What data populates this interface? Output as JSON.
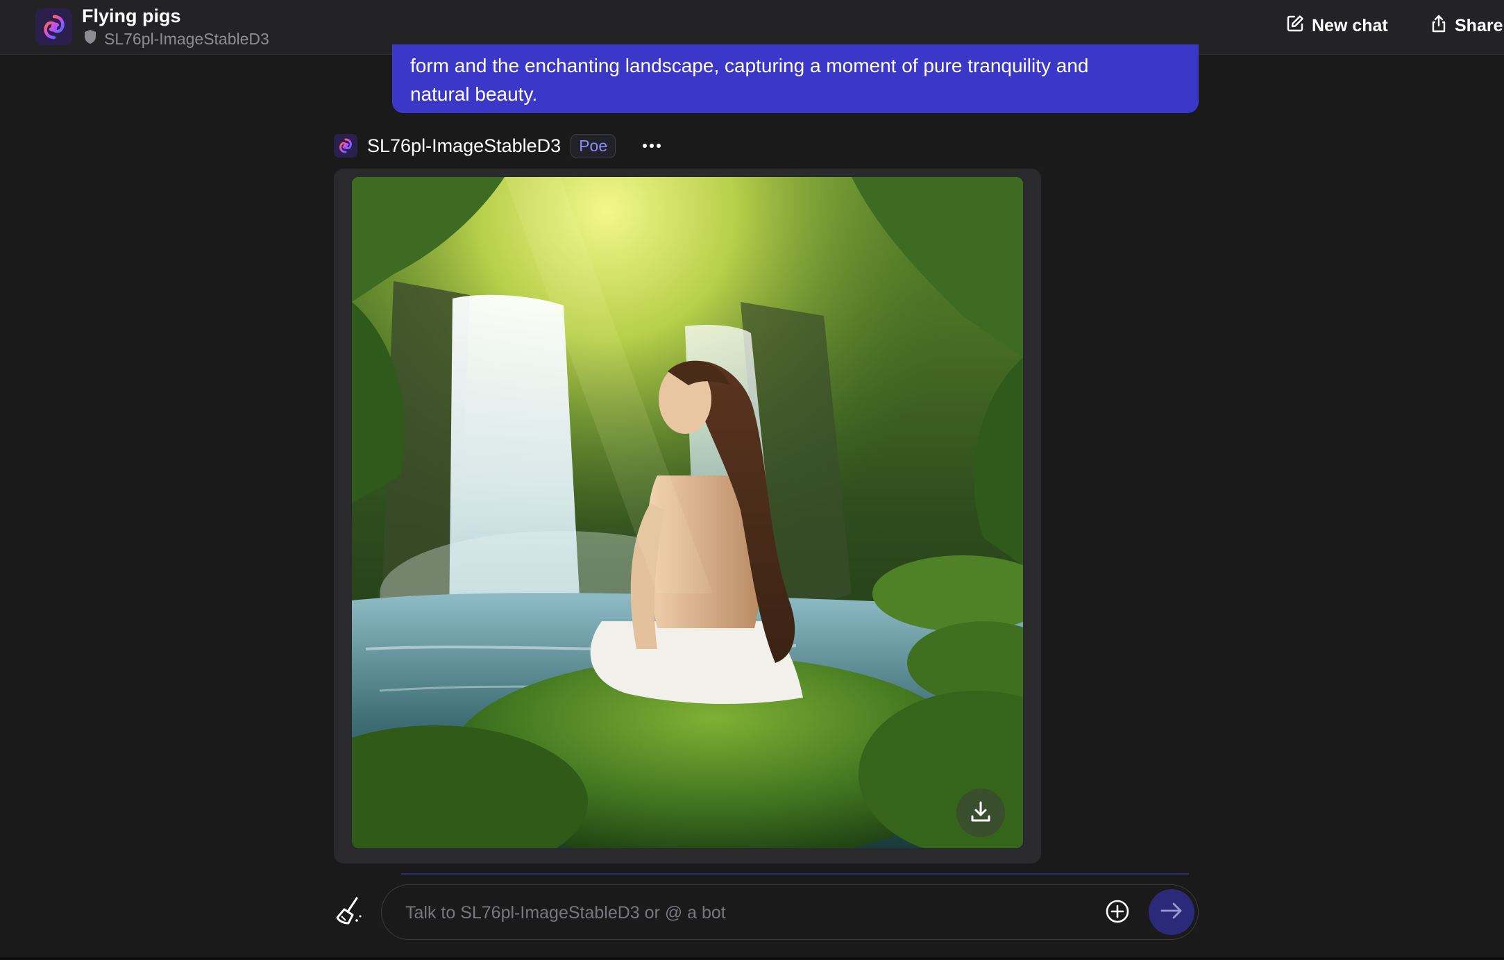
{
  "header": {
    "chat_title": "Flying pigs",
    "bot_name": "SL76pl-ImageStableD3",
    "new_chat_label": "New chat",
    "share_label": "Share"
  },
  "user_message": {
    "lines": [
      "form and the enchanting landscape, capturing a moment of pure tranquility and",
      "natural beauty."
    ]
  },
  "bot_message": {
    "bot_name": "SL76pl-ImageStableD3",
    "badge": "Poe",
    "image_subject": "woman seated on mossy rock facing a forest waterfall"
  },
  "composer": {
    "placeholder": "Talk to SL76pl-ImageStableD3 or @ a bot",
    "value": ""
  },
  "colors": {
    "background": "#1a1a1b",
    "header": "#232325",
    "user_bubble": "#3b37c8",
    "badge_text": "#8f8bff",
    "send_button": "#2b2a78"
  },
  "icons": {
    "app_logo": "poe-logo-icon",
    "bot_shield": "shield-icon",
    "new_chat": "edit-icon",
    "share": "share-icon",
    "more": "more-horizontal-icon",
    "download": "download-icon",
    "clear": "broom-icon",
    "attach": "plus-circle-icon",
    "send": "arrow-right-icon"
  }
}
